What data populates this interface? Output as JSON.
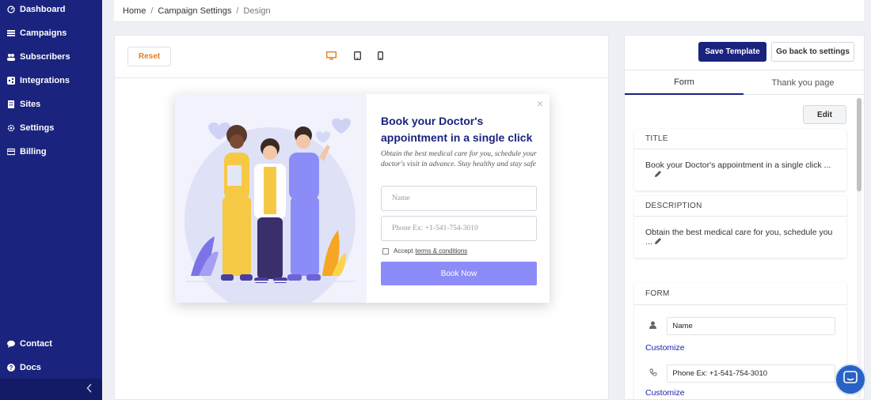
{
  "sidebar": {
    "top_items": [
      {
        "label": "Dashboard",
        "icon": "dashboard-icon"
      },
      {
        "label": "Campaigns",
        "icon": "list-icon"
      },
      {
        "label": "Subscribers",
        "icon": "users-icon"
      },
      {
        "label": "Integrations",
        "icon": "share-icon"
      },
      {
        "label": "Sites",
        "icon": "building-icon"
      },
      {
        "label": "Settings",
        "icon": "gear-icon"
      },
      {
        "label": "Billing",
        "icon": "credit-card-icon"
      }
    ],
    "bottom_items": [
      {
        "label": "Contact",
        "icon": "chat-icon"
      },
      {
        "label": "Docs",
        "icon": "question-icon"
      }
    ],
    "collapse_icon": "chevron-left-icon"
  },
  "breadcrumb": {
    "items": [
      "Home",
      "Campaign Settings"
    ],
    "separator": "/",
    "current": "Design"
  },
  "preview": {
    "reset_label": "Reset",
    "devices": [
      "desktop-icon",
      "tablet-icon",
      "mobile-icon"
    ],
    "active_device": "desktop",
    "accent_color": "#e67e22",
    "popup": {
      "close": "×",
      "title": "Book your Doctor's appointment in a single click",
      "description": "Obtain the best medical care for you, schedule your doctor's visit in advance. Stay healthy and stay safe",
      "name_placeholder": "Name",
      "phone_placeholder": "Phone Ex: +1-541-754-3010",
      "accept_text": "Accept",
      "terms_text": "terms & conditions",
      "button_label": "Book Now",
      "button_color": "#8c8cf8"
    }
  },
  "panel": {
    "save_label": "Save Template",
    "back_label": "Go back to settings",
    "tabs": [
      {
        "label": "Form",
        "active": true
      },
      {
        "label": "Thank you page",
        "active": false
      }
    ],
    "edit_label": "Edit",
    "title_section": {
      "heading": "TITLE",
      "value": "Book your Doctor's appointment in a single click ..."
    },
    "description_section": {
      "heading": "DESCRIPTION",
      "value": "Obtain the best medical care for you, schedule you ..."
    },
    "form_section": {
      "heading": "FORM",
      "fields": [
        {
          "icon": "user-icon",
          "value": "Name",
          "customize": "Customize"
        },
        {
          "icon": "phone-icon",
          "value": "Phone Ex: +1-541-754-3010",
          "customize": "Customize"
        }
      ]
    },
    "primary_color": "#1a237e"
  },
  "chat_widget": {
    "icon": "chat-widget-icon"
  }
}
